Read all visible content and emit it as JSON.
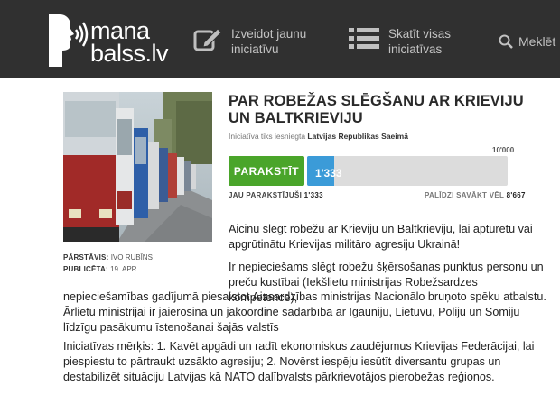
{
  "header": {
    "logo_line1": "mana",
    "logo_line2": "balss.lv",
    "nav_create_line1": "Izveidot jaunu",
    "nav_create_line2": "iniciatīvu",
    "nav_browse_line1": "Skatīt visas",
    "nav_browse_line2": "iniciatīvas",
    "search_label": "Meklēt"
  },
  "initiative": {
    "title": "PAR ROBEŽAS SLĒGŠANU AR KRIEVIJU UN BALTKRIEVIJU",
    "submitted_prefix": "Iniciatīva tiks iesniegta",
    "submitted_to": "Latvijas Republikas Saeimā",
    "target": "10'000",
    "sign_label": "PARAKSTĪT",
    "progress_value": "1'333",
    "progress_fraction": 0.1333,
    "signed_label": "JAU PARAKSTĪJUŠI",
    "signed_count": "1'333",
    "remaining_label": "PALĪDZI SAVĀKT VĒL",
    "remaining_count": "8'667",
    "author_label": "PĀRSTĀVIS:",
    "author_name": "IVO RUBĪNS",
    "published_label": "PUBLICĒTA:",
    "published_date": "19. APR"
  },
  "body": {
    "p1": "Aicinu slēgt robežu ar Krieviju un Baltkrieviju, lai apturētu vai apgrūtinātu Krievijas militāro agresiju Ukrainā!",
    "p2": "Ir nepieciešams slēgt robežu šķērsošanas punktus personu un preču kustībai (Iekšlietu ministrijas Robežsardzes kompetence),",
    "p3": "nepieciešamības gadījumā piesaistot Aizsardzības ministrijas Nacionālo bruņoto spēku atbalstu. Ārlietu ministrijai ir jāierosina un jākoordinē sadarbība ar Igauniju, Lietuvu, Poliju un Somiju līdzīgu pasākumu īstenošanai šajās valstīs",
    "p4": "Iniciatīvas mērķis: 1. Kavēt apgādi un radīt ekonomiskus zaudējumus Krievijas Federācijai, lai piespiestu to pārtraukt uzsākto agresiju; 2. Novērst iespēju iesūtīt diversantu grupas un destabilizēt situāciju Latvijas kā NATO dalībvalsts pārkrievotājos pierobežas reģionos."
  },
  "colors": {
    "header_bg": "#303030",
    "sign_green": "#4aa52a",
    "progress_blue": "#3b9bd8"
  },
  "icons": [
    "profile-sound-logo-icon",
    "edit-pencil-icon",
    "list-icon",
    "search-icon"
  ]
}
